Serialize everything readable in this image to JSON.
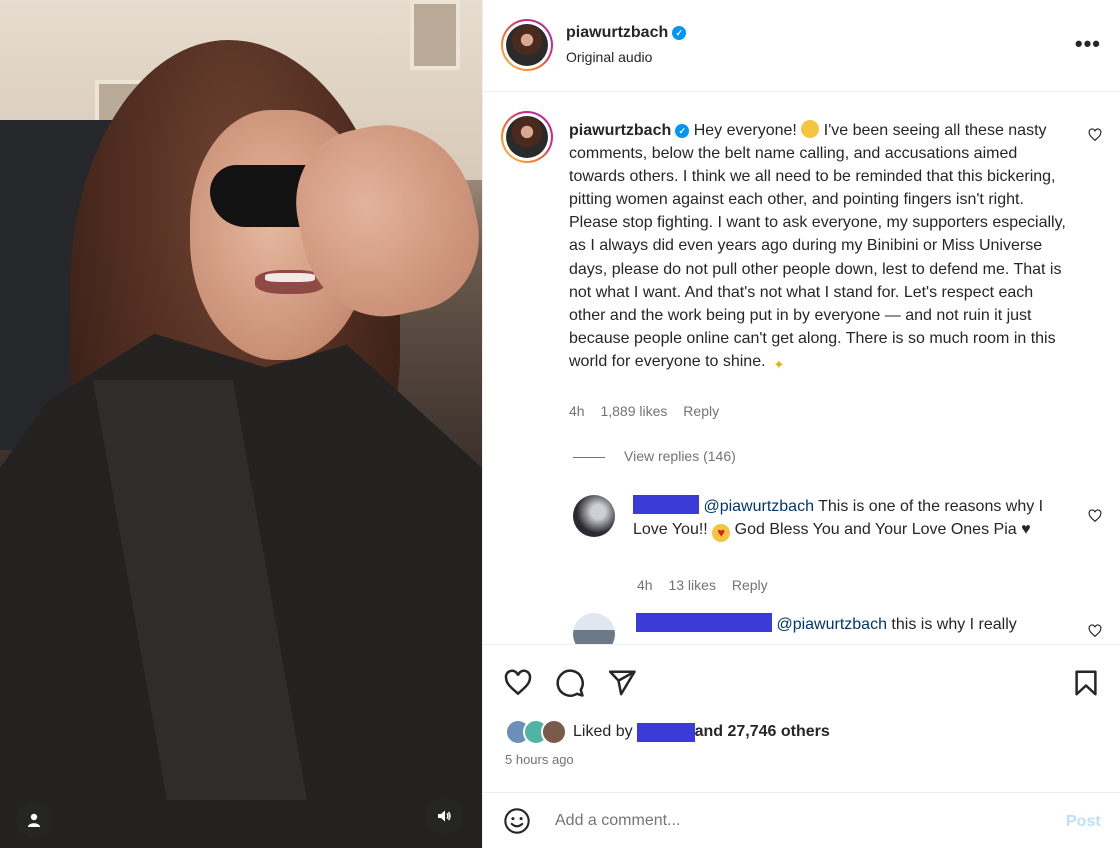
{
  "post": {
    "username": "piawurtzbach",
    "audio": "Original audio",
    "more_label": "•••"
  },
  "caption": {
    "username": "piawurtzbach",
    "greeting": "Hey everyone!",
    "body": "I've been seeing all these nasty comments, below the belt name calling, and accusations aimed towards others. I think we all need to be reminded that this bickering, pitting women against each other, and pointing fingers isn't right. Please stop fighting. I want to ask everyone, my supporters especially, as I always did even years ago during my Binibini or Miss Universe days, please do not pull other people down, lest to defend me. That is not what I want. And that's not what I stand for. Let's respect each other and the work being put in by everyone — and not ruin it just because people online can't get along. There is so much room in this world for everyone to shine.",
    "time": "4h",
    "likes": "1,889 likes",
    "reply": "Reply",
    "view_replies": "View replies (146)"
  },
  "replies": [
    {
      "mention": "@piawurtzbach",
      "text_a": "This is one of the reasons why I Love You!!",
      "text_b": "God Bless You and Your Love Ones Pia",
      "time": "4h",
      "likes": "13 likes",
      "reply": "Reply"
    },
    {
      "mention": "@piawurtzbach",
      "text": "this is why I really"
    }
  ],
  "liked_by": {
    "prefix": "Liked by",
    "suffix": "and 27,746 others"
  },
  "posted": "5 hours ago",
  "comment_box": {
    "placeholder": "Add a comment...",
    "post_label": "Post"
  },
  "colors": {
    "verified": "#0095f6",
    "censor": "#3b3bd8",
    "mention": "#00376b"
  }
}
